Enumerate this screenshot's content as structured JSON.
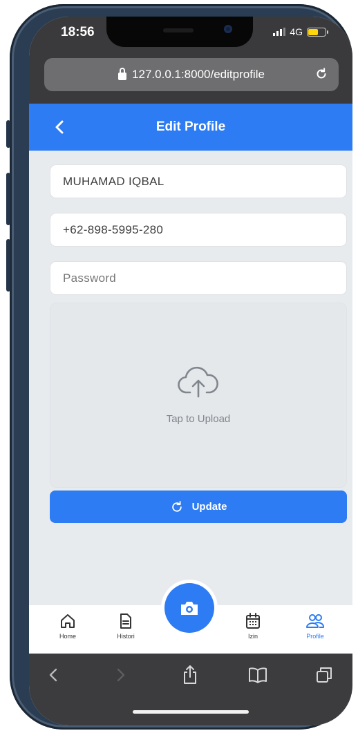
{
  "status_bar": {
    "time": "18:56",
    "network": "4G"
  },
  "browser": {
    "url": "127.0.0.1:8000/editprofile"
  },
  "header": {
    "title": "Edit Profile"
  },
  "form": {
    "name_value": "MUHAMAD IQBAL",
    "phone_value": "+62-898-5995-280",
    "password_placeholder": "Password",
    "upload_label": "Tap to Upload",
    "update_label": "Update"
  },
  "bottom_nav": {
    "items": [
      {
        "label": "Home",
        "icon": "home-icon"
      },
      {
        "label": "Histori",
        "icon": "document-icon"
      },
      {
        "label": "Izin",
        "icon": "calendar-icon"
      },
      {
        "label": "Profile",
        "icon": "users-icon"
      }
    ],
    "center_icon": "camera-icon",
    "active": "Profile"
  },
  "colors": {
    "primary": "#2d7cf3",
    "background": "#e8ebee",
    "frame": "#2b3d52"
  }
}
